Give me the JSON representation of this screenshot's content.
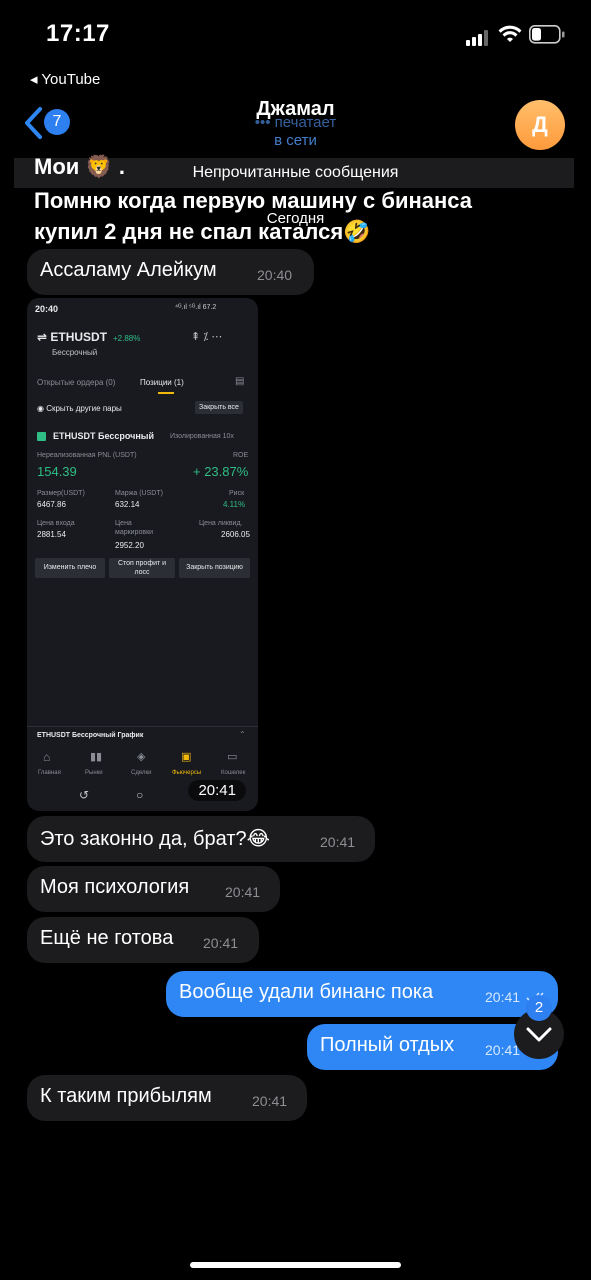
{
  "status_bar": {
    "time": "17:17",
    "back_app": "◂ YouTube"
  },
  "header": {
    "unread_count": "7",
    "name": "Джамал",
    "status_typing": "••• печатает",
    "status_online": "в сети",
    "avatar_letter": "Д"
  },
  "unread_divider": "Непрочитанные сообщения",
  "date_divider": "Сегодня",
  "top_message": {
    "line1": "Мои 🦁 .",
    "line2": "Помню когда первую машину с бинанса",
    "line3": "купил 2 дня не спал катался🤣"
  },
  "messages": [
    {
      "text": "Ассаламу Алейкум",
      "time": "20:40"
    },
    {
      "text": "Это законно да, брат?😂",
      "time": "20:41"
    },
    {
      "text": "Моя психология",
      "time": "20:41"
    },
    {
      "text": "Ещё не готова",
      "time": "20:41"
    },
    {
      "text": "Вообще удали бинанс пока",
      "time": "20:41"
    },
    {
      "text": "Полный отдых",
      "time": "20:41"
    },
    {
      "text": "К таким прибылям",
      "time": "20:41"
    }
  ],
  "photo": {
    "time": "20:41",
    "screen": {
      "status_time": "20:40",
      "status_right": "⁴ᴳ.ıl ⁵ᴳ.ıl 67.2",
      "pair": "⇌ ETHUSDT",
      "pair_change": "+2.88%",
      "pair_sub": "Бессрочный",
      "tab_orders": "Открытые ордера (0)",
      "tab_positions": "Позиции (1)",
      "hide_pairs": "Скрыть другие пары",
      "close_all": "Закрыть все",
      "position_title": "ETHUSDT Бессрочный",
      "position_mode": "Изолированная 10x",
      "pnl_label": "Нереализованная PNL (USDT)",
      "roe_label": "ROE",
      "pnl_value": "154.39",
      "roe_value": "+ 23.87%",
      "size_label": "Размер(USDT)",
      "size_value": "6467.86",
      "margin_label": "Маржа (USDT)",
      "margin_value": "632.14",
      "risk_label": "Риск",
      "risk_value": "4.11%",
      "entry_label": "Цена входа",
      "entry_value": "2881.54",
      "mark_label_1": "Цена",
      "mark_label_2": "маркировки",
      "mark_value": "2952.20",
      "liq_label": "Цена ликвид.",
      "liq_value": "2606.05",
      "btn_leverage": "Изменить плечо",
      "btn_tpsl_1": "Стоп профит и",
      "btn_tpsl_2": "лосс",
      "btn_close": "Закрыть позицию",
      "chart_bar": "ETHUSDT Бессрочный  График",
      "nav": [
        "Главная",
        "Рынки",
        "Сделки",
        "Фьючерсы",
        "Кошелек"
      ],
      "accent_green": "#2ebd85",
      "accent_yellow": "#f0b90b"
    }
  },
  "scroll_badge": "2",
  "colors": {
    "bubble_in": "#1c1c1e",
    "bubble_out": "#2e87f5",
    "accent": "#2e7ff0"
  }
}
